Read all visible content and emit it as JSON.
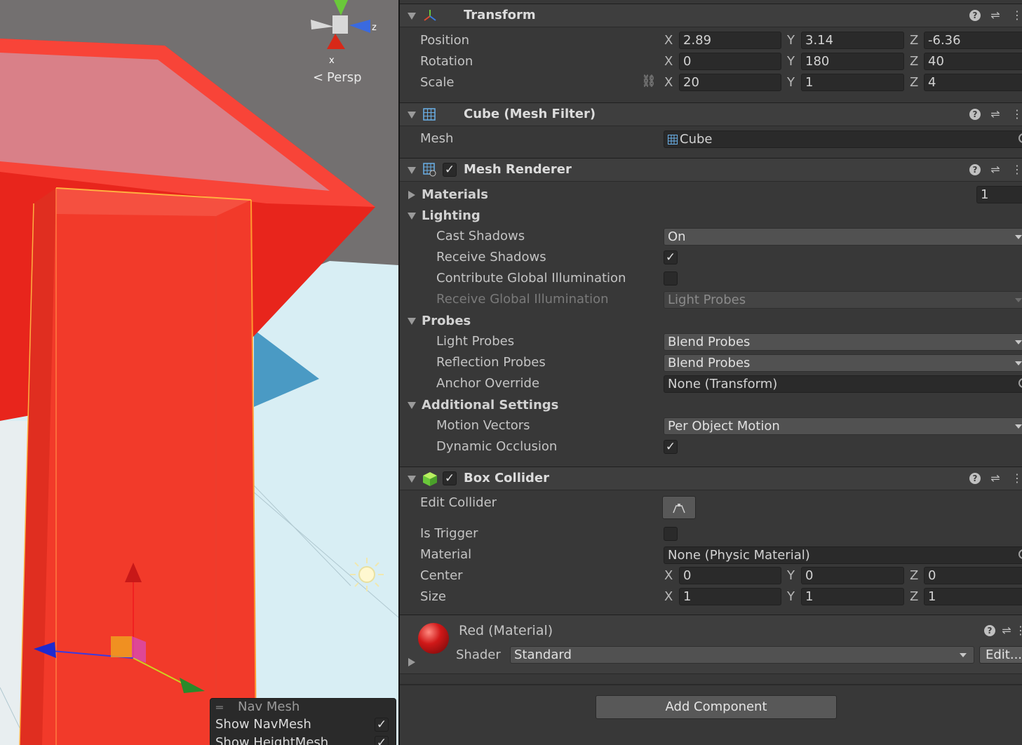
{
  "scene": {
    "gizmo_axis_z": "z",
    "gizmo_axis_x": "x",
    "persp_label": "Persp",
    "navmesh_overlay": {
      "title": "Nav Mesh",
      "rows": [
        {
          "label": "Show NavMesh",
          "checked": true
        },
        {
          "label": "Show HeightMesh",
          "checked": true
        }
      ]
    }
  },
  "inspector": {
    "transform": {
      "title": "Transform",
      "position_label": "Position",
      "rotation_label": "Rotation",
      "scale_label": "Scale",
      "axis_x": "X",
      "axis_y": "Y",
      "axis_z": "Z",
      "position": {
        "x": "2.89",
        "y": "3.14",
        "z": "-6.36"
      },
      "rotation": {
        "x": "0",
        "y": "180",
        "z": "40"
      },
      "scale": {
        "x": "20",
        "y": "1",
        "z": "4"
      }
    },
    "mesh_filter": {
      "title": "Cube (Mesh Filter)",
      "mesh_label": "Mesh",
      "mesh_value": "Cube"
    },
    "mesh_renderer": {
      "title": "Mesh Renderer",
      "enabled": true,
      "materials_label": "Materials",
      "materials_count": "1",
      "lighting_label": "Lighting",
      "cast_shadows_label": "Cast Shadows",
      "cast_shadows_value": "On",
      "receive_shadows_label": "Receive Shadows",
      "receive_shadows": true,
      "contribute_gi_label": "Contribute Global Illumination",
      "contribute_gi": false,
      "receive_gi_label": "Receive Global Illumination",
      "receive_gi_value": "Light Probes",
      "probes_label": "Probes",
      "light_probes_label": "Light Probes",
      "light_probes_value": "Blend Probes",
      "reflection_probes_label": "Reflection Probes",
      "reflection_probes_value": "Blend Probes",
      "anchor_override_label": "Anchor Override",
      "anchor_override_value": "None (Transform)",
      "additional_settings_label": "Additional Settings",
      "motion_vectors_label": "Motion Vectors",
      "motion_vectors_value": "Per Object Motion",
      "dynamic_occlusion_label": "Dynamic Occlusion",
      "dynamic_occlusion": true
    },
    "box_collider": {
      "title": "Box Collider",
      "enabled": true,
      "edit_collider_label": "Edit Collider",
      "is_trigger_label": "Is Trigger",
      "is_trigger": false,
      "material_label": "Material",
      "material_value": "None (Physic Material)",
      "center_label": "Center",
      "size_label": "Size",
      "center": {
        "x": "0",
        "y": "0",
        "z": "0"
      },
      "size": {
        "x": "1",
        "y": "1",
        "z": "1"
      }
    },
    "material": {
      "title": "Red (Material)",
      "shader_label": "Shader",
      "shader_value": "Standard",
      "edit_label": "Edit..."
    },
    "add_component_label": "Add Component"
  },
  "colors": {
    "inspector_bg": "#383838",
    "header_bg": "#3e3e3e",
    "field_bg": "#2a2a2a",
    "object_red": "#f23a2a",
    "sky_blue": "#d6eef4"
  }
}
